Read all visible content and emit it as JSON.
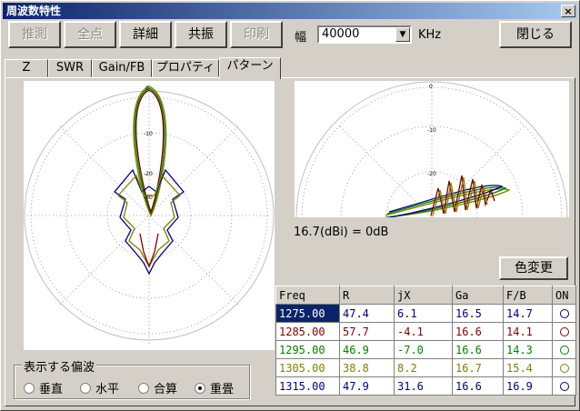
{
  "window": {
    "title": "周波数特性",
    "close": "×"
  },
  "toolbar": {
    "buttons": [
      "推測",
      "全点",
      "詳細",
      "共振",
      "印刷"
    ],
    "width_label": "幅",
    "width_value": "40000",
    "unit": "KHz",
    "close_label": "閉じる"
  },
  "tabs": [
    "Z",
    "SWR",
    "Gain/FB",
    "プロパティ",
    "パターン"
  ],
  "plots": {
    "ring_labels": [
      "0",
      "-10",
      "-20",
      "-30"
    ]
  },
  "info": {
    "reference": "16.7(dBi) = 0dB"
  },
  "color_button": "色変更",
  "table": {
    "headers": [
      "Freq",
      "R",
      "jX",
      "Ga",
      "F/B",
      "ON"
    ],
    "rows": [
      {
        "freq": "1275.00",
        "r": "47.4",
        "jx": "6.1",
        "ga": "16.5",
        "fb": "14.7",
        "color": "#000080"
      },
      {
        "freq": "1285.00",
        "r": "57.7",
        "jx": "-4.1",
        "ga": "16.6",
        "fb": "14.1",
        "color": "#800000"
      },
      {
        "freq": "1295.00",
        "r": "46.9",
        "jx": "-7.0",
        "ga": "16.6",
        "fb": "14.3",
        "color": "#008000"
      },
      {
        "freq": "1305.00",
        "r": "38.8",
        "jx": "8.2",
        "ga": "16.7",
        "fb": "15.4",
        "color": "#808000"
      },
      {
        "freq": "1315.00",
        "r": "47.9",
        "jx": "31.6",
        "ga": "16.6",
        "fb": "16.9",
        "color": "#000080"
      }
    ]
  },
  "polarization": {
    "title": "表示する偏波",
    "options": [
      "垂直",
      "水平",
      "合算",
      "重畳"
    ],
    "selected": 3
  }
}
